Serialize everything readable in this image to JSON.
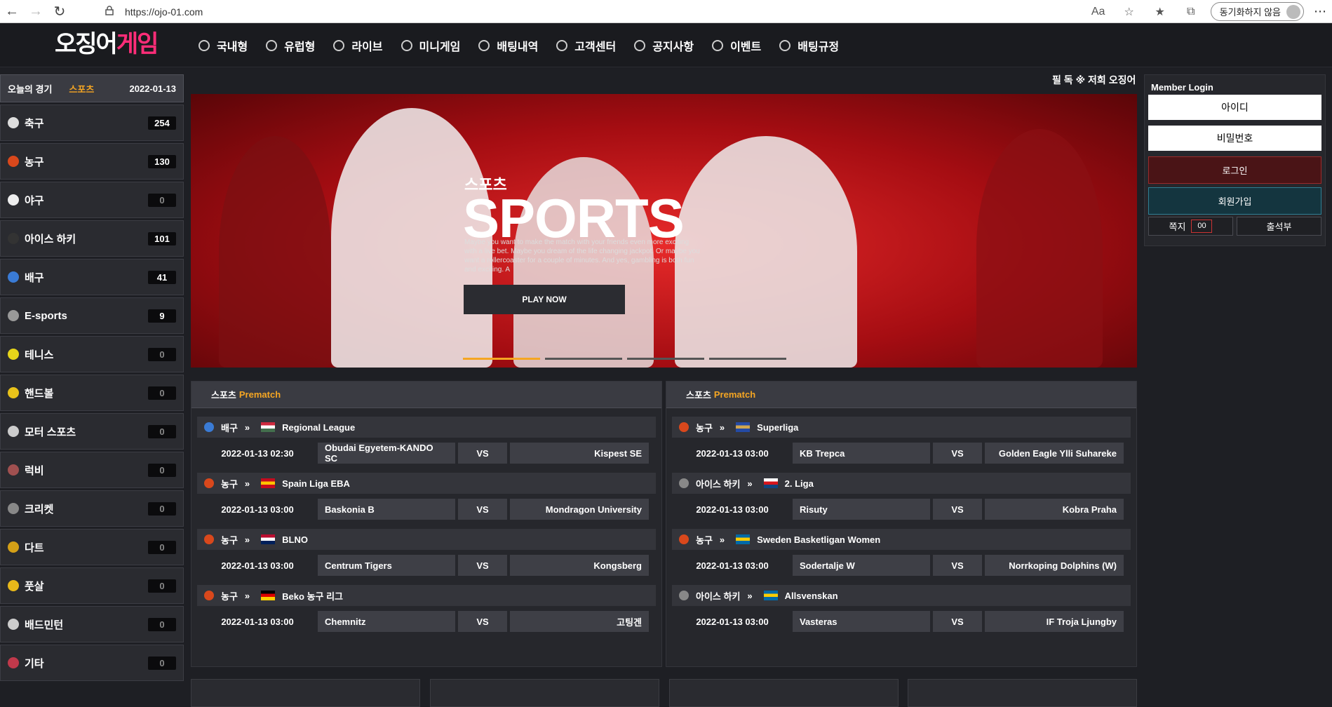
{
  "browser": {
    "url": "https://ojo-01.com",
    "sync_label": "동기화하지 않음"
  },
  "header": {
    "logo_a": "오징어",
    "logo_b": "게임",
    "menu": [
      {
        "label": "국내형",
        "icon": "soccer-ball-icon"
      },
      {
        "label": "유럽형",
        "icon": "soccer-ball-icon"
      },
      {
        "label": "라이브",
        "icon": "clock-icon"
      },
      {
        "label": "미니게임",
        "icon": "gamepad-icon"
      },
      {
        "label": "배팅내역",
        "icon": "target-icon"
      },
      {
        "label": "고객센터",
        "icon": "headset-icon"
      },
      {
        "label": "공지사항",
        "icon": "notice-icon"
      },
      {
        "label": "이벤트",
        "icon": "diamond-icon"
      },
      {
        "label": "배팅규정",
        "icon": "document-icon"
      }
    ]
  },
  "sidebar": {
    "today_label": "오늘의 경기",
    "today_sport": "스포츠",
    "today_date": "2022-01-13",
    "sports": [
      {
        "name": "축구",
        "count": "254",
        "color": "#dddddd"
      },
      {
        "name": "농구",
        "count": "130",
        "color": "#d9481c"
      },
      {
        "name": "야구",
        "count": "0",
        "color": "#eeeeee"
      },
      {
        "name": "아이스 하키",
        "count": "101",
        "color": "#333333"
      },
      {
        "name": "배구",
        "count": "41",
        "color": "#3a7bd5"
      },
      {
        "name": "E-sports",
        "count": "9",
        "color": "#999999"
      },
      {
        "name": "테니스",
        "count": "0",
        "color": "#e6d51a"
      },
      {
        "name": "핸드볼",
        "count": "0",
        "color": "#e8c21a"
      },
      {
        "name": "모터 스포츠",
        "count": "0",
        "color": "#cccccc"
      },
      {
        "name": "럭비",
        "count": "0",
        "color": "#a05050"
      },
      {
        "name": "크리켓",
        "count": "0",
        "color": "#888888"
      },
      {
        "name": "다트",
        "count": "0",
        "color": "#d4a017"
      },
      {
        "name": "풋살",
        "count": "0",
        "color": "#e8b81a"
      },
      {
        "name": "배드민턴",
        "count": "0",
        "color": "#cccccc"
      },
      {
        "name": "기타",
        "count": "0",
        "color": "#c0394b"
      }
    ]
  },
  "ticker": "필 독 ※ 저희 오징어",
  "banner": {
    "kicker": "스포츠",
    "title": "SPORTS",
    "desc": "Maybe you want to make the match with your friends even more exciting with a live bet. Maybe you dream of the life changing jackpot. Or maybe you want a rollercoaster for a couple of minutes. And yes, gambling is both fun and exciting. A",
    "play_label": "PLAY NOW"
  },
  "prematch": [
    {
      "head_sport": "스포츠",
      "head_label": "Prematch",
      "games": [
        {
          "sport": "배구",
          "league": "Regional League",
          "flag": [
            "#cd2a3e",
            "#ffffff",
            "#436f4d"
          ],
          "ball": "#3a7bd5",
          "time": "2022-01-13 02:30",
          "home": "Obudai Egyetem-KANDO SC",
          "vs": "VS",
          "away": "Kispest SE"
        },
        {
          "sport": "농구",
          "league": "Spain Liga EBA",
          "flag": [
            "#c60b1e",
            "#ffc400",
            "#c60b1e"
          ],
          "ball": "#d9481c",
          "time": "2022-01-13 03:00",
          "home": "Baskonia B",
          "vs": "VS",
          "away": "Mondragon University"
        },
        {
          "sport": "농구",
          "league": "BLNO",
          "flag": [
            "#ba0c2f",
            "#ffffff",
            "#00205b"
          ],
          "ball": "#d9481c",
          "time": "2022-01-13 03:00",
          "home": "Centrum Tigers",
          "vs": "VS",
          "away": "Kongsberg"
        },
        {
          "sport": "농구",
          "league": "Beko 농구 리그",
          "flag": [
            "#000000",
            "#dd0000",
            "#ffce00"
          ],
          "ball": "#d9481c",
          "time": "2022-01-13 03:00",
          "home": "Chemnitz",
          "vs": "VS",
          "away": "고팅겐"
        }
      ]
    },
    {
      "head_sport": "스포츠",
      "head_label": "Prematch",
      "games": [
        {
          "sport": "농구",
          "league": "Superliga",
          "flag": [
            "#244aa5",
            "#d0a650",
            "#244aa5"
          ],
          "ball": "#d9481c",
          "time": "2022-01-13 03:00",
          "home": "KB Trepca",
          "vs": "VS",
          "away": "Golden Eagle Ylli Suhareke"
        },
        {
          "sport": "아이스 하키",
          "league": "2. Liga",
          "flag": [
            "#ffffff",
            "#d7141a",
            "#11457e"
          ],
          "ball": "#888888",
          "time": "2022-01-13 03:00",
          "home": "Risuty",
          "vs": "VS",
          "away": "Kobra Praha"
        },
        {
          "sport": "농구",
          "league": "Sweden Basketligan Women",
          "flag": [
            "#006aa7",
            "#fecc00",
            "#006aa7"
          ],
          "ball": "#d9481c",
          "time": "2022-01-13 03:00",
          "home": "Sodertalje W",
          "vs": "VS",
          "away": "Norrkoping Dolphins (W)"
        },
        {
          "sport": "아이스 하키",
          "league": "Allsvenskan",
          "flag": [
            "#006aa7",
            "#fecc00",
            "#006aa7"
          ],
          "ball": "#888888",
          "time": "2022-01-13 03:00",
          "home": "Vasteras",
          "vs": "VS",
          "away": "IF Troja Ljungby"
        }
      ]
    }
  ],
  "login": {
    "title": "Member Login",
    "id_placeholder": "아이디",
    "pw_placeholder": "비밀번호",
    "login_label": "로그인",
    "join_label": "회원가입",
    "message_label": "쪽지",
    "message_count": "00",
    "attendance_label": "출석부"
  }
}
